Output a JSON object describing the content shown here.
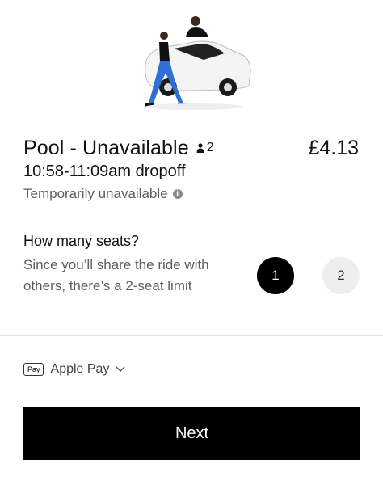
{
  "ride": {
    "title": "Pool - Unavailable",
    "capacity": "2",
    "price": "£4.13",
    "eta": "10:58-11:09am dropoff",
    "status": "Temporarily unavailable"
  },
  "seats": {
    "title": "How many seats?",
    "description": "Since you’ll share the ride with others, there’s a 2-seat limit",
    "options": [
      "1",
      "2"
    ],
    "selected": "1"
  },
  "payment": {
    "badge_text": "Pay",
    "method": "Apple Pay"
  },
  "next_label": "Next"
}
